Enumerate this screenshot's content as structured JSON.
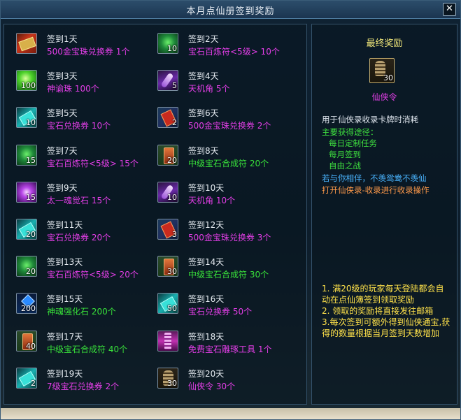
{
  "window": {
    "title": "本月点仙册签到奖励",
    "close_label": "✕"
  },
  "checkin_items": [
    {
      "day": "签到1天",
      "reward": "500金宝珠兑换券  1个",
      "qty": "",
      "icon": "gold-ticket-icon",
      "color": "magenta"
    },
    {
      "day": "签到2天",
      "reward": "宝石百炼符<5级>  10个",
      "qty": "10",
      "icon": "jade-talisman-icon",
      "color": "magenta"
    },
    {
      "day": "签到3天",
      "reward": "神谕珠  100个",
      "qty": "100",
      "icon": "oracle-orb-icon",
      "color": "magenta"
    },
    {
      "day": "签到4天",
      "reward": "天机角  5个",
      "qty": "5",
      "icon": "heaven-horn-icon",
      "color": "magenta"
    },
    {
      "day": "签到5天",
      "reward": "宝石兑换券  10个",
      "qty": "10",
      "icon": "gem-ticket-icon",
      "color": "magenta"
    },
    {
      "day": "签到6天",
      "reward": "500金宝珠兑换券  2个",
      "qty": "2",
      "icon": "gold-ticket-icon",
      "color": "magenta"
    },
    {
      "day": "签到7天",
      "reward": "宝石百炼符<5级>  15个",
      "qty": "15",
      "icon": "jade-talisman-icon",
      "color": "magenta"
    },
    {
      "day": "签到8天",
      "reward": "中级宝石合成符  20个",
      "qty": "20",
      "icon": "scroll-icon",
      "color": "green"
    },
    {
      "day": "签到9天",
      "reward": "太一魂觉石  15个",
      "qty": "15",
      "icon": "soul-stone-icon",
      "color": "magenta"
    },
    {
      "day": "签到10天",
      "reward": "天机角  10个",
      "qty": "10",
      "icon": "heaven-horn-icon",
      "color": "magenta"
    },
    {
      "day": "签到11天",
      "reward": "宝石兑换券  20个",
      "qty": "20",
      "icon": "gem-ticket-icon",
      "color": "magenta"
    },
    {
      "day": "签到12天",
      "reward": "500金宝珠兑换券  3个",
      "qty": "3",
      "icon": "gold-ticket-icon",
      "color": "magenta"
    },
    {
      "day": "签到13天",
      "reward": "宝石百炼符<5级>  20个",
      "qty": "20",
      "icon": "jade-talisman-icon",
      "color": "magenta"
    },
    {
      "day": "签到14天",
      "reward": "中级宝石合成符  30个",
      "qty": "30",
      "icon": "scroll-icon",
      "color": "green"
    },
    {
      "day": "签到15天",
      "reward": "神魂强化石  200个",
      "qty": "200",
      "icon": "blue-crystal-icon",
      "color": "green"
    },
    {
      "day": "签到16天",
      "reward": "宝石兑换券  50个",
      "qty": "50",
      "icon": "gem-ticket-icon",
      "color": "magenta"
    },
    {
      "day": "签到17天",
      "reward": "中级宝石合成符  40个",
      "qty": "40",
      "icon": "scroll-icon",
      "color": "green"
    },
    {
      "day": "签到18天",
      "reward": "免费宝石雕琢工具  1个",
      "qty": "",
      "icon": "carving-tool-icon",
      "color": "magenta"
    },
    {
      "day": "签到19天",
      "reward": "7级宝石兑换券  2个",
      "qty": "2",
      "icon": "gem-ticket-icon",
      "color": "magenta"
    },
    {
      "day": "签到20天",
      "reward": "仙侠令  30个",
      "qty": "30",
      "icon": "xianxia-token-icon",
      "color": "magenta"
    }
  ],
  "final_reward": {
    "heading": "最终奖励",
    "item_name": "仙侠令",
    "qty": "30",
    "icon": "xianxia-token-icon",
    "desc_line1": "用于仙侠录收录卡牌时消耗",
    "desc_line2": "主要获得途径：",
    "desc_line3": "每日定制任务",
    "desc_line4": "每月签到",
    "desc_line5": "自由之战",
    "desc_line6": "若与你相伴，不羡鸳鸯不羡仙",
    "desc_line7": "打开仙侠录-收录进行收录操作"
  },
  "rules": {
    "line1": "1. 满20级的玩家每天登陆都会自",
    "line2": "动在点仙簿签到领取奖励",
    "line3": "2. 领取的奖励将直接发往邮箱",
    "line4": "3.每次签到可额外得到仙侠通宝,获",
    "line5": "得的数量根据当月签到天数增加"
  },
  "colors": {
    "magenta": "#e23ee6",
    "green": "#38e03a",
    "title_yellow": "#f1e77a",
    "rules_yellow": "#ffe24a"
  }
}
